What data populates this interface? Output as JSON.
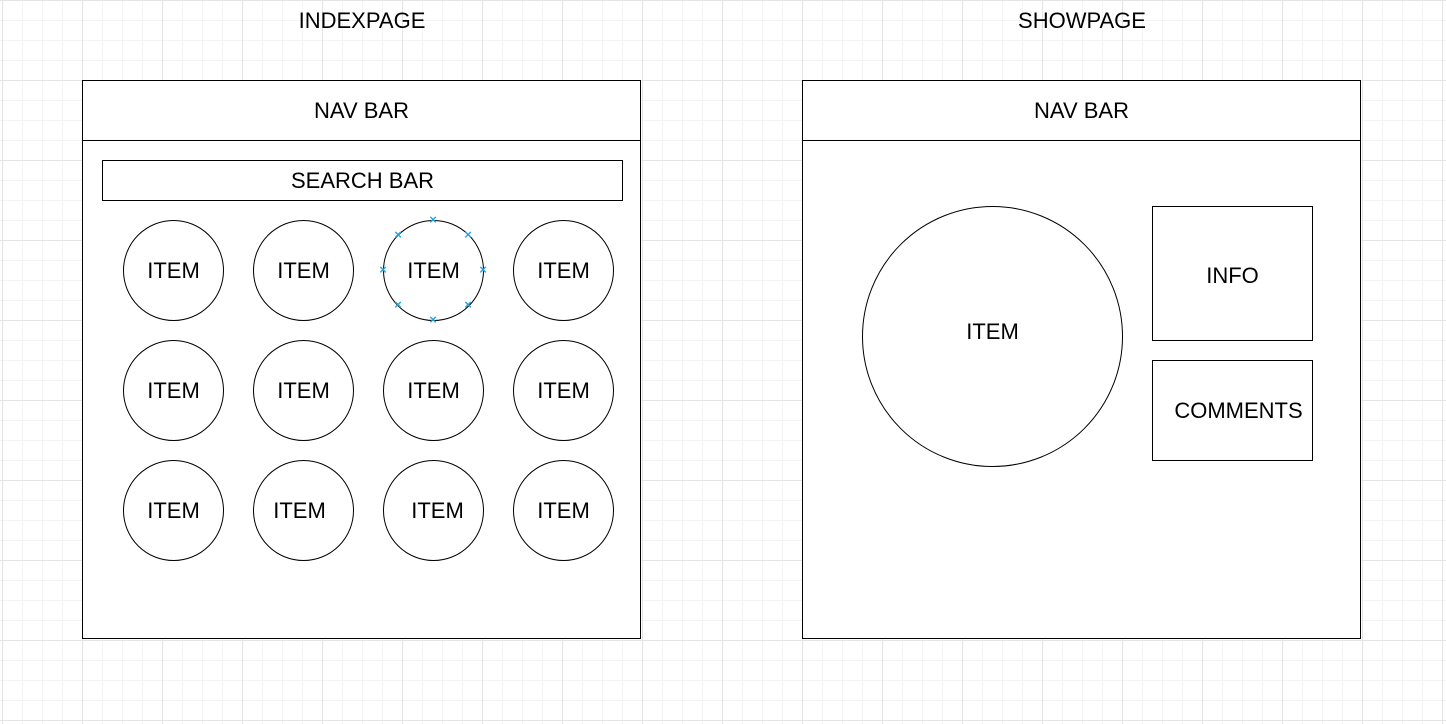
{
  "index_page": {
    "title": "INDEXPAGE",
    "nav_bar_label": "NAV BAR",
    "search_bar_label": "SEARCH BAR",
    "items": [
      "ITEM",
      "ITEM",
      "ITEM",
      "ITEM",
      "ITEM",
      "ITEM",
      "ITEM",
      "ITEM",
      "ITEM",
      "ITEM",
      "ITEM",
      "ITEM"
    ],
    "selected_item_index": 2
  },
  "show_page": {
    "title": "SHOWPAGE",
    "nav_bar_label": "NAV BAR",
    "item_label": "ITEM",
    "info_label": "INFO",
    "comments_label": "COMMENTS"
  },
  "colors": {
    "selection_handle": "#29a3e0",
    "grid_line": "#e4e4e4",
    "stroke": "#000000"
  },
  "icons": {
    "selection_handle": "selection-handle-icon"
  }
}
